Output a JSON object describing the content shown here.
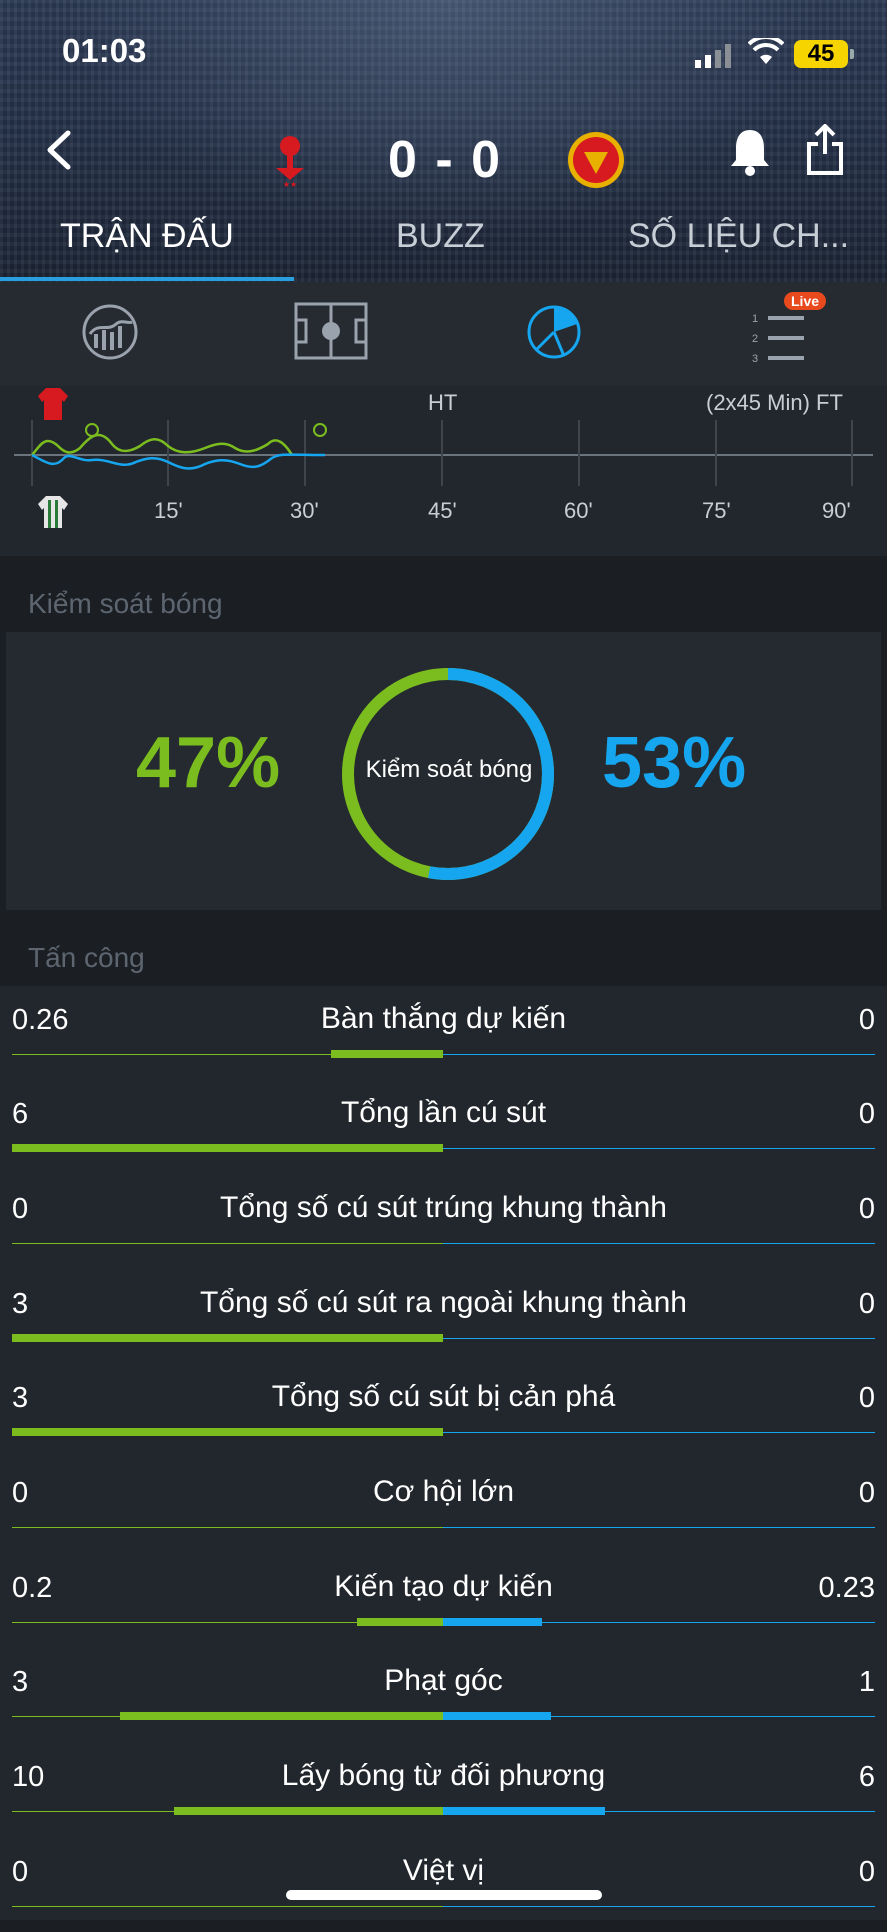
{
  "status_bar": {
    "time": "01:03",
    "battery": "45"
  },
  "match": {
    "score": "0 - 0"
  },
  "tabs": [
    {
      "label": "TRẬN ĐẤU",
      "active": true
    },
    {
      "label": "BUZZ",
      "active": false
    },
    {
      "label": "SỐ LIỆU CH...",
      "active": false
    }
  ],
  "iconbar": {
    "live_badge": "Live"
  },
  "timeline": {
    "ht_label": "HT",
    "ft_label": "(2x45 Min) FT",
    "ticks": [
      "15'",
      "30'",
      "45'",
      "60'",
      "75'",
      "90'"
    ]
  },
  "possession": {
    "section_title": "Kiểm soát bóng",
    "home": "47%",
    "away": "53%",
    "center_label": "Kiểm soát bóng",
    "home_fraction": 0.47,
    "away_fraction": 0.53
  },
  "attack": {
    "section_title": "Tấn công",
    "rows": [
      {
        "label": "Bàn thắng dự kiến",
        "home": "0.26",
        "away": "0",
        "home_share": 0.26,
        "away_share": 0
      },
      {
        "label": "Tổng lần cú sút",
        "home": "6",
        "away": "0",
        "home_share": 1,
        "away_share": 0
      },
      {
        "label": "Tổng số cú sút trúng khung thành",
        "home": "0",
        "away": "0",
        "home_share": 0,
        "away_share": 0
      },
      {
        "label": "Tổng số cú sút ra ngoài khung thành",
        "home": "3",
        "away": "0",
        "home_share": 1,
        "away_share": 0
      },
      {
        "label": "Tổng số cú sút bị cản phá",
        "home": "3",
        "away": "0",
        "home_share": 1,
        "away_share": 0
      },
      {
        "label": "Cơ hội lớn",
        "home": "0",
        "away": "0",
        "home_share": 0,
        "away_share": 0
      },
      {
        "label": "Kiến tạo dự kiến",
        "home": "0.2",
        "away": "0.23",
        "home_share": 0.2,
        "away_share": 0.23
      },
      {
        "label": "Phạt góc",
        "home": "3",
        "away": "1",
        "home_share": 0.75,
        "away_share": 0.25
      },
      {
        "label": "Lấy bóng từ đối phương",
        "home": "10",
        "away": "6",
        "home_share": 0.625,
        "away_share": 0.375
      },
      {
        "label": "Việt vị",
        "home": "0",
        "away": "0",
        "home_share": 0,
        "away_share": 0
      }
    ]
  },
  "colors": {
    "home": "#7bbd1f",
    "away": "#16a6ef",
    "accent": "#2a9fe0"
  }
}
